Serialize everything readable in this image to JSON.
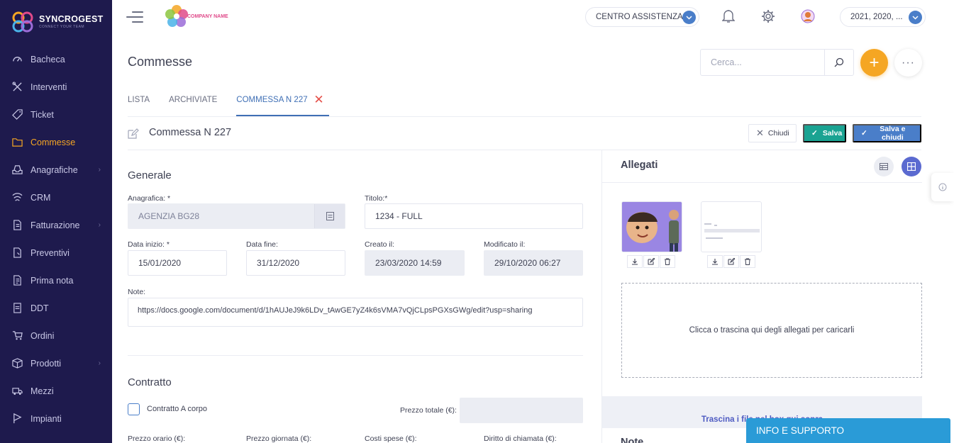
{
  "app": {
    "name": "SYNCROGEST",
    "tagline": "CONNECT YOUR TEAM",
    "company": "COMPANY NAME"
  },
  "colors": {
    "sidebar": "#1e1a4d",
    "accent": "#f5a623",
    "primary": "#4a7ec9",
    "success": "#1aa392",
    "danger": "#e5504a"
  },
  "sidebar": {
    "items": [
      {
        "label": "Bacheca",
        "icon": "dashboard-icon",
        "active": false,
        "submenu": false
      },
      {
        "label": "Interventi",
        "icon": "tools-icon",
        "active": false,
        "submenu": false
      },
      {
        "label": "Ticket",
        "icon": "ticket-icon",
        "active": false,
        "submenu": false
      },
      {
        "label": "Commesse",
        "icon": "folder-icon",
        "active": true,
        "submenu": false
      },
      {
        "label": "Anagrafiche",
        "icon": "inbox-icon",
        "active": false,
        "submenu": true
      },
      {
        "label": "CRM",
        "icon": "crm-icon",
        "active": false,
        "submenu": false
      },
      {
        "label": "Fatturazione",
        "icon": "invoice-icon",
        "active": false,
        "submenu": true
      },
      {
        "label": "Preventivi",
        "icon": "quote-icon",
        "active": false,
        "submenu": false
      },
      {
        "label": "Prima nota",
        "icon": "notes-icon",
        "active": false,
        "submenu": false
      },
      {
        "label": "DDT",
        "icon": "ddt-icon",
        "active": false,
        "submenu": false
      },
      {
        "label": "Ordini",
        "icon": "cart-icon",
        "active": false,
        "submenu": false
      },
      {
        "label": "Prodotti",
        "icon": "box-icon",
        "active": false,
        "submenu": true
      },
      {
        "label": "Mezzi",
        "icon": "truck-icon",
        "active": false,
        "submenu": false
      },
      {
        "label": "Impianti",
        "icon": "flag-icon",
        "active": false,
        "submenu": false
      }
    ]
  },
  "topbar": {
    "support_label": "CENTRO ASSISTENZA",
    "years_label": "2021, 2020, ..."
  },
  "page": {
    "title": "Commesse",
    "search_placeholder": "Cerca...",
    "add_label": "+",
    "more_label": "···"
  },
  "tabs": [
    {
      "label": "LISTA",
      "active": false
    },
    {
      "label": "ARCHIVIATE",
      "active": false
    },
    {
      "label": "COMMESSA N 227",
      "active": true,
      "closable": true
    }
  ],
  "record": {
    "title": "Commessa N 227",
    "close_label": "Chiudi",
    "save_label": "Salva",
    "save_close_label": "Salva e chiudi"
  },
  "generale": {
    "section_title": "Generale",
    "anagrafica_label": "Anagrafica: *",
    "anagrafica_value": "AGENZIA BG28",
    "titolo_label": "Titolo:*",
    "titolo_value": "1234 - FULL",
    "data_inizio_label": "Data inizio: *",
    "data_inizio_value": "15/01/2020",
    "data_fine_label": "Data fine:",
    "data_fine_value": "31/12/2020",
    "creato_label": "Creato il:",
    "creato_value": "23/03/2020 14:59",
    "modificato_label": "Modificato il:",
    "modificato_value": "29/10/2020 06:27",
    "note_label": "Note:",
    "note_value": "https://docs.google.com/document/d/1hAUJeJ9k6LDv_tAwGE7yZ4k6sVMA7vQjCLpsPGXsGWg/edit?usp=sharing"
  },
  "contratto": {
    "section_title": "Contratto",
    "a_corpo_label": "Contratto A corpo",
    "prezzo_totale_label": "Prezzo totale (€):",
    "prezzo_orario_label": "Prezzo orario (€):",
    "prezzo_giornata_label": "Prezzo giornata (€):",
    "costi_spese_label": "Costi spese (€):",
    "diritto_chiamata_label": "Diritto di chiamata (€):"
  },
  "allegati": {
    "title": "Allegati",
    "dropzone_text": "Clicca o trascina qui degli allegati per caricarli",
    "drag_hint": "Trascina i file nel box qui sopra",
    "next_section": "Note"
  },
  "info_bar": {
    "label": "INFO E SUPPORTO"
  }
}
